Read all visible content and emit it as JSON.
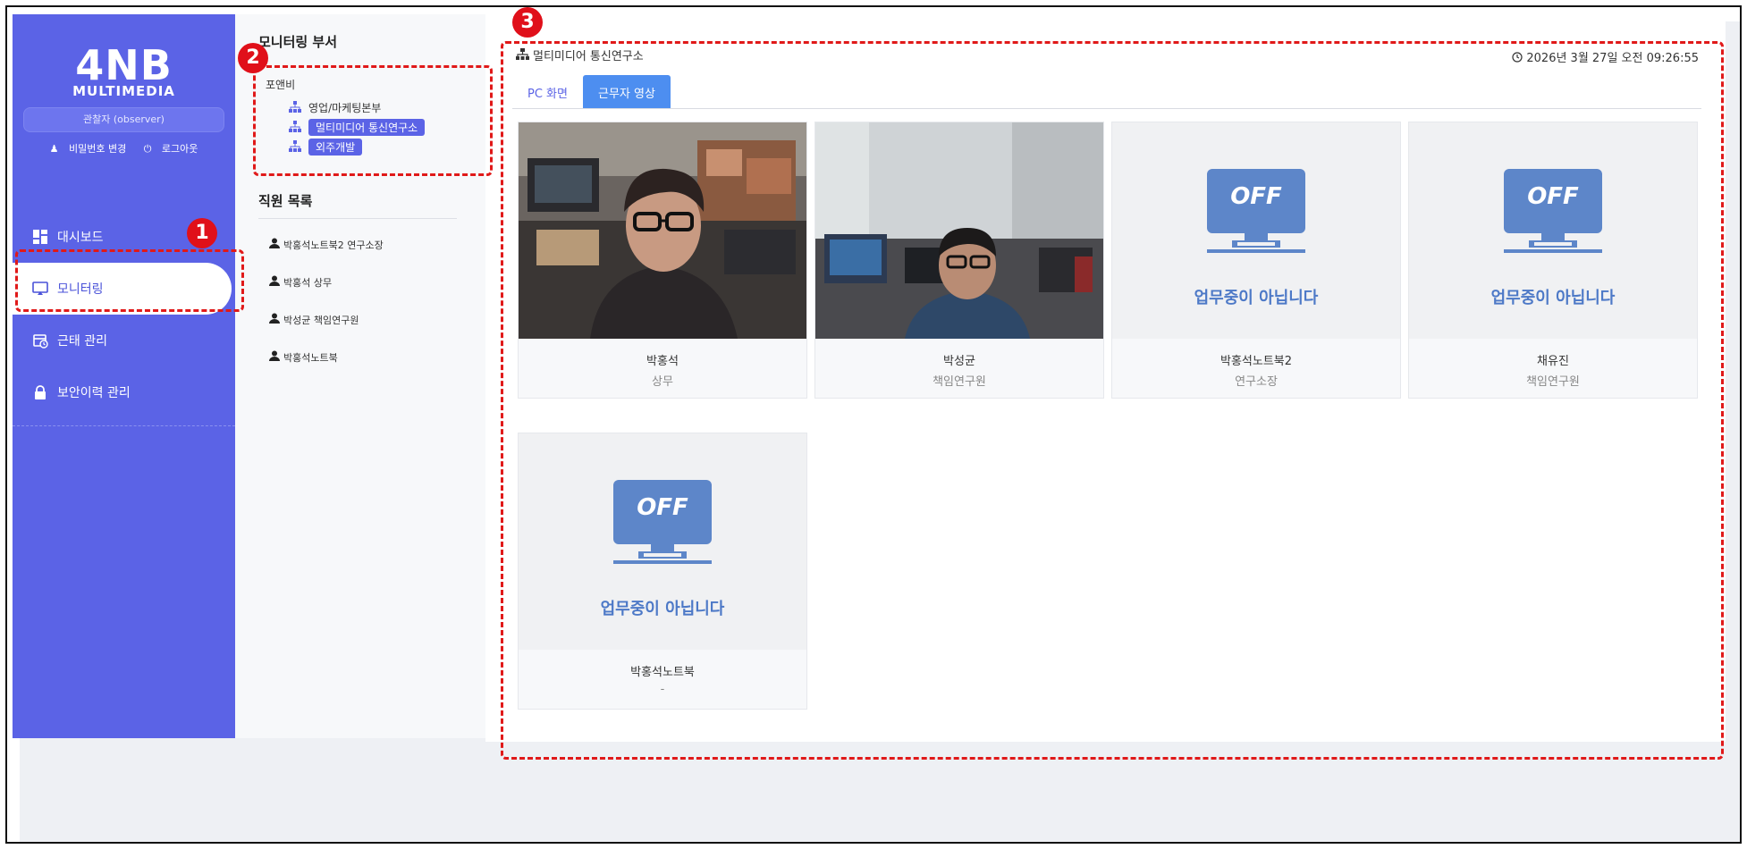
{
  "sidebar": {
    "logo_main": "4NB",
    "logo_sub": "MULTIMEDIA",
    "role": "관찰자 (observer)",
    "change_password": "비밀번호 변경",
    "logout": "로그아웃",
    "items": [
      {
        "label": "대시보드",
        "icon": "dashboard-icon",
        "active": false
      },
      {
        "label": "모니터링",
        "icon": "monitor-icon",
        "active": true
      },
      {
        "label": "근태 관리",
        "icon": "calendar-clock-icon",
        "active": false
      },
      {
        "label": "보안이력 관리",
        "icon": "lock-icon",
        "active": false
      }
    ]
  },
  "dept_panel": {
    "title": "모니터링 부서",
    "root": "포앤비",
    "departments": [
      {
        "label": "영업/마케팅본부",
        "selected": false
      },
      {
        "label": "멀티미디어 통신연구소",
        "selected": true
      },
      {
        "label": "외주개발",
        "selected": true
      }
    ],
    "employee_title": "직원 목록",
    "employees": [
      "박홍석노트북2 연구소장",
      "박홍석 상무",
      "박성균 책임연구원",
      "박홍석노트북"
    ]
  },
  "main": {
    "breadcrumb": "멀티미디어 통신연구소",
    "datetime": "2026년 3월 27일 오전 09:26:55",
    "tabs": [
      {
        "label": "PC 화면",
        "active": false
      },
      {
        "label": "근무자 영상",
        "active": true
      }
    ],
    "off_label": "OFF",
    "off_message": "업무중이 아닙니다",
    "cards": [
      {
        "name": "박홍석",
        "role": "상무",
        "status": "video"
      },
      {
        "name": "박성균",
        "role": "책임연구원",
        "status": "video"
      },
      {
        "name": "박홍석노트북2",
        "role": "연구소장",
        "status": "off"
      },
      {
        "name": "채유진",
        "role": "책임연구원",
        "status": "off"
      },
      {
        "name": "박홍석노트북",
        "role": "-",
        "status": "off"
      }
    ]
  },
  "annotations": [
    "1",
    "2",
    "3"
  ],
  "colors": {
    "sidebar": "#5b63e6",
    "accent": "#4d8ef0",
    "off_blue": "#5d86c9",
    "annotation_red": "#e01919"
  }
}
